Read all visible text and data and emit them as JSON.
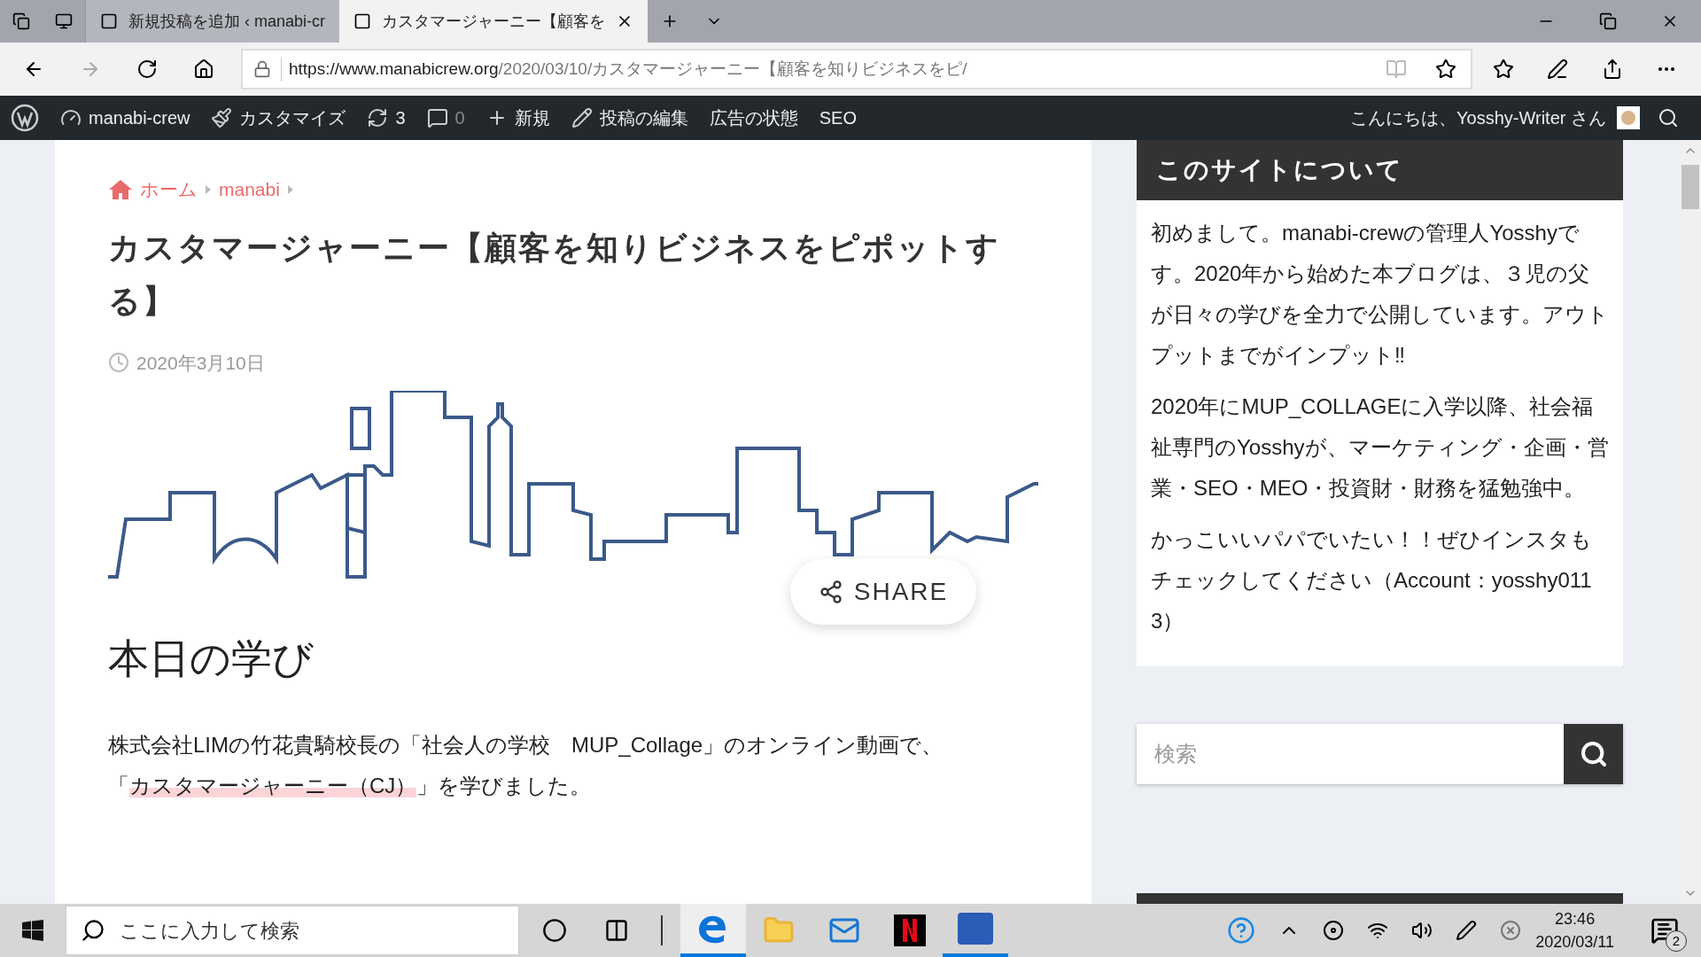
{
  "browser": {
    "tabs": [
      {
        "title": "新規投稿を追加 ‹ manabi-cr",
        "selected": false
      },
      {
        "title": "カスタマージャーニー【顧客を",
        "selected": true
      }
    ],
    "url_host": "https://www.manabicrew.org",
    "url_path": "/2020/03/10/カスタマージャーニー【顧客を知りビジネスをピ/"
  },
  "admin_bar": {
    "items": [
      {
        "kind": "site",
        "label": "manabi-crew"
      },
      {
        "kind": "customize",
        "label": "カスタマイズ"
      },
      {
        "kind": "updates",
        "label": "3"
      },
      {
        "kind": "comments",
        "label": "0"
      },
      {
        "kind": "new",
        "label": "新規"
      },
      {
        "kind": "edit",
        "label": "投稿の編集"
      },
      {
        "kind": "text",
        "label": "広告の状態"
      },
      {
        "kind": "text",
        "label": "SEO"
      }
    ],
    "greeting": "こんにちは、Yosshy-Writer さん"
  },
  "article": {
    "breadcrumb": [
      "ホーム",
      "manabi"
    ],
    "title": "カスタマージャーニー【顧客を知りビジネスをピポットする】",
    "date": "2020年3月10日",
    "share": "SHARE",
    "heading": "本日の学び",
    "paragraph": [
      {
        "text": "株式会社LIMの竹花貴騎校長の「社会人の学校　MUP_Collage」のオンライン動画で、「",
        "highlight": false
      },
      {
        "text": "カスタマージャーニー（CJ）",
        "highlight": true
      },
      {
        "text": "」を学びました。",
        "highlight": false
      }
    ]
  },
  "sidebar": {
    "title": "このサイトについて",
    "paragraphs": [
      "初めまして。manabi-crewの管理人Yosshyです。2020年から始めた本ブログは、３児の父が日々の学びを全力で公開しています。アウトプットまでがインプット‼",
      "2020年にMUP_COLLAGEに入学以降、社会福祉専門のYosshyが、マーケティング・企画・営業・SEO・MEO・投資財・財務を猛勉強中。",
      "かっこいいパパでいたい！！ぜひインスタもチェックしてください（Account：yosshy0113）"
    ],
    "search_placeholder": "検索"
  },
  "taskbar": {
    "search_placeholder": "ここに入力して検索",
    "time": "23:46",
    "date": "2020/03/11",
    "notifications": "2"
  }
}
